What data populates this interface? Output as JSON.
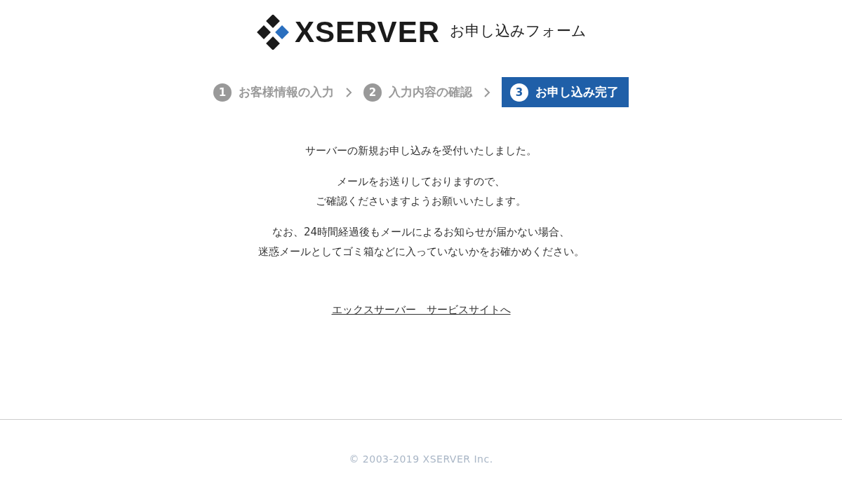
{
  "header": {
    "logo": "XSERVER",
    "title": "お申し込みフォーム"
  },
  "steps": [
    {
      "number": "1",
      "label": "お客様情報の入力",
      "selected": false
    },
    {
      "number": "2",
      "label": "入力内容の確認",
      "selected": false
    },
    {
      "number": "3",
      "label": "お申し込み完了",
      "selected": true
    }
  ],
  "messages": [
    [
      "サーバーの新規お申し込みを受付いたしました。"
    ],
    [
      "メールをお送りしておりますので、",
      "ご確認くださいますようお願いいたします。"
    ],
    [
      "なお、24時間経過後もメールによるお知らせが届かない場合、",
      "迷惑メールとしてゴミ箱などに入っていないかをお確かめください。"
    ]
  ],
  "link": "エックスサーバー　サービスサイトへ",
  "footer": "© 2003-2019 XSERVER Inc."
}
